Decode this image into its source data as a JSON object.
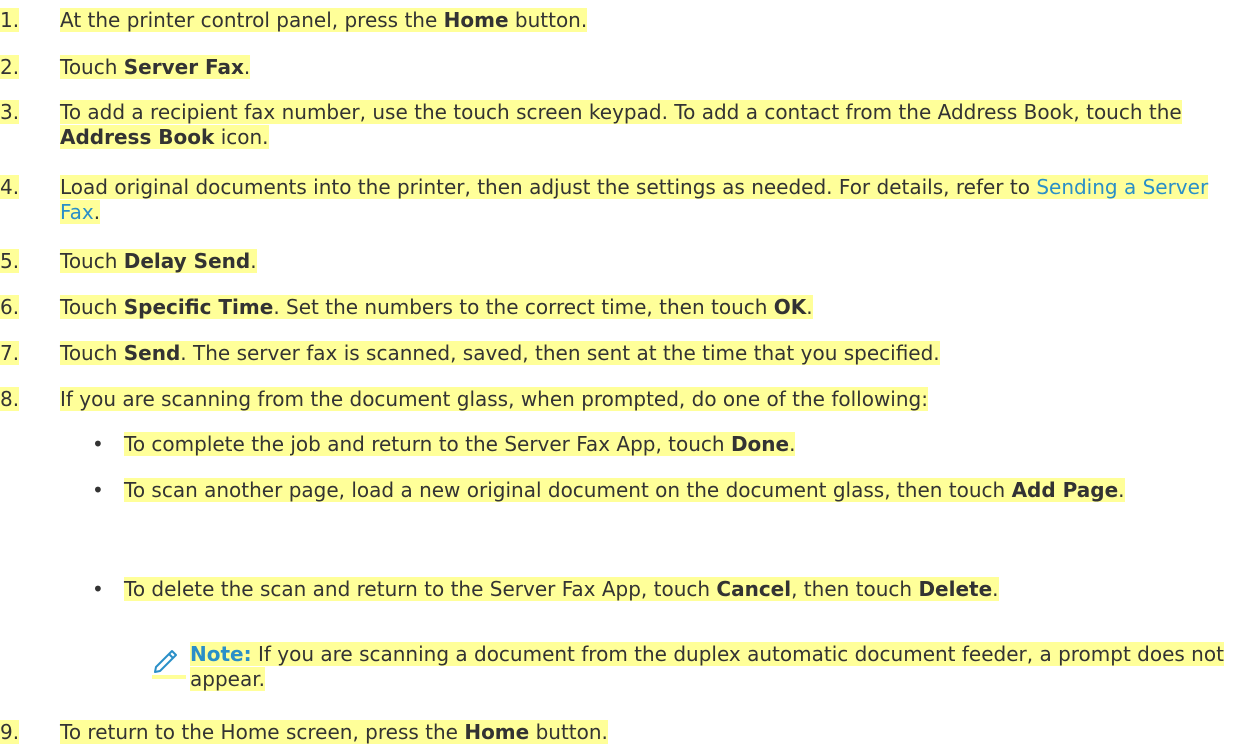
{
  "steps": [
    {
      "num": "1.",
      "parts": [
        {
          "t": "At the printer control panel, press the ",
          "b": false
        },
        {
          "t": "Home",
          "b": true
        },
        {
          "t": " button.",
          "b": false
        }
      ]
    },
    {
      "num": "2.",
      "parts": [
        {
          "t": "Touch ",
          "b": false
        },
        {
          "t": "Server Fax",
          "b": true
        },
        {
          "t": ".",
          "b": false
        }
      ]
    },
    {
      "num": "3.",
      "parts": [
        {
          "t": "To add a recipient fax number, use the touch screen keypad. To add a contact from the Address Book, touch the ",
          "b": false
        },
        {
          "t": "Address Book",
          "b": true
        },
        {
          "t": " icon.",
          "b": false
        }
      ]
    },
    {
      "num": "4.",
      "parts": [
        {
          "t": "Load original documents into the printer, then adjust the settings as needed. For details, refer to ",
          "b": false
        },
        {
          "t": "Sending a Server Fax",
          "link": true
        },
        {
          "t": ".",
          "b": false
        }
      ]
    },
    {
      "num": "5.",
      "parts": [
        {
          "t": "Touch ",
          "b": false
        },
        {
          "t": "Delay Send",
          "b": true
        },
        {
          "t": ".",
          "b": false
        }
      ]
    },
    {
      "num": "6.",
      "parts": [
        {
          "t": "Touch ",
          "b": false
        },
        {
          "t": "Specific Time",
          "b": true
        },
        {
          "t": ". Set the numbers to the correct time, then touch ",
          "b": false
        },
        {
          "t": "OK",
          "b": true
        },
        {
          "t": ".",
          "b": false
        }
      ]
    },
    {
      "num": "7.",
      "parts": [
        {
          "t": "Touch ",
          "b": false
        },
        {
          "t": "Send",
          "b": true
        },
        {
          "t": ". The server fax is scanned, saved, then sent at the time that you specified.",
          "b": false
        }
      ]
    },
    {
      "num": "8.",
      "parts": [
        {
          "t": "If you are scanning from the document glass, when prompted, do one of the following:",
          "b": false
        }
      ]
    },
    {
      "num": "9.",
      "parts": [
        {
          "t": "To return to the Home screen, press the ",
          "b": false
        },
        {
          "t": "Home",
          "b": true
        },
        {
          "t": " button.",
          "b": false
        }
      ]
    }
  ],
  "bullets": [
    {
      "parts": [
        {
          "t": "To complete the job and return to the Server Fax App, touch ",
          "b": false
        },
        {
          "t": "Done",
          "b": true
        },
        {
          "t": ".",
          "b": false
        }
      ]
    },
    {
      "parts": [
        {
          "t": "To scan another page, load a new original document on the document glass, then touch ",
          "b": false
        },
        {
          "t": "Add Page",
          "b": true
        },
        {
          "t": ".",
          "b": false
        }
      ]
    },
    {
      "parts": [
        {
          "t": "To delete the scan and return to the Server Fax App, touch ",
          "b": false
        },
        {
          "t": "Cancel",
          "b": true
        },
        {
          "t": ", then touch ",
          "b": false
        },
        {
          "t": "Delete",
          "b": true
        },
        {
          "t": ".",
          "b": false
        }
      ]
    }
  ],
  "bullet_char": "•",
  "note": {
    "label": "Note:",
    "text": " If you are scanning a document from the duplex automatic document feeder, a prompt does not appear.",
    "icon": "pencil-icon"
  },
  "colors": {
    "highlight": "#ffff99",
    "link": "#2a8fc8",
    "text": "#333333"
  }
}
